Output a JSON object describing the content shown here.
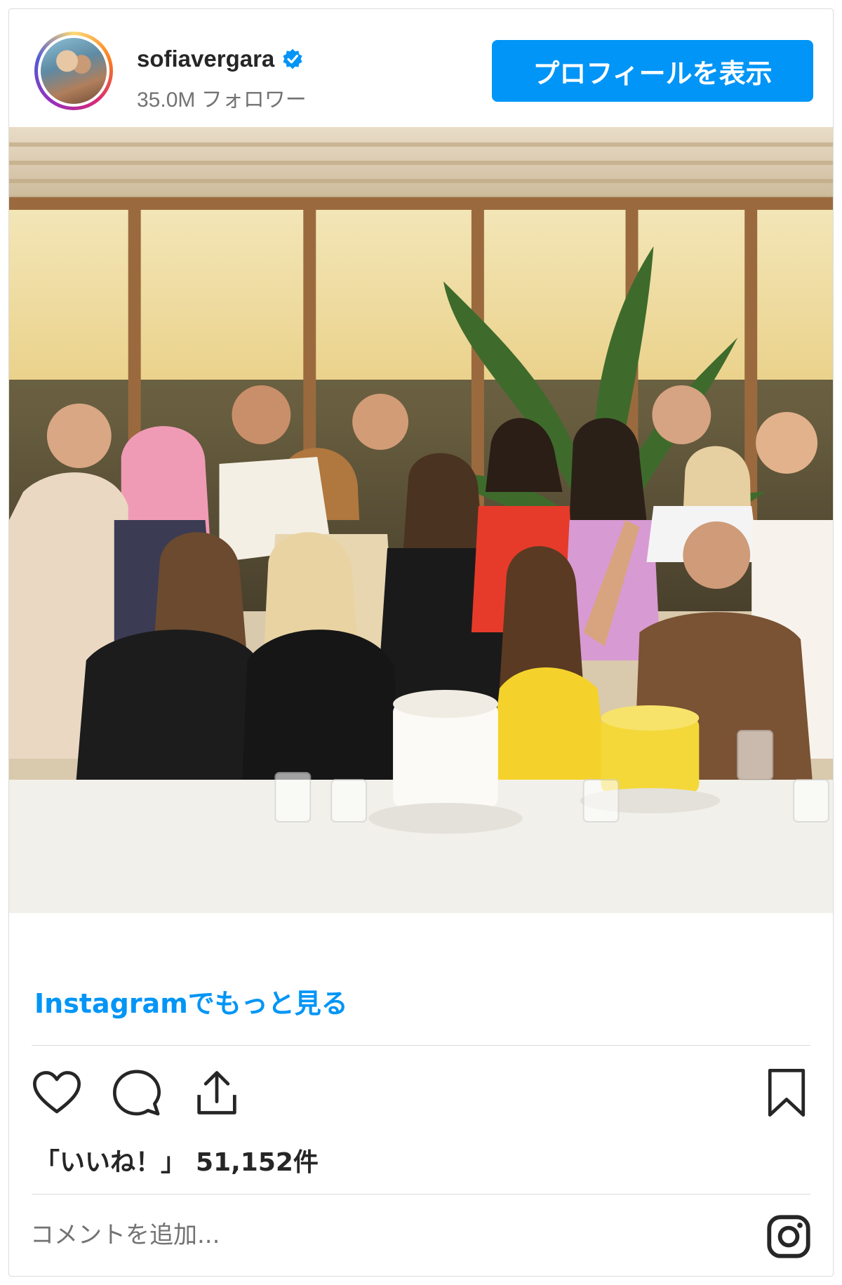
{
  "header": {
    "username": "sofiavergara",
    "followers": "35.0M フォロワー",
    "profile_button": "プロフィールを表示"
  },
  "post": {
    "more_link": "Instagramでもっと見る",
    "likes_label": "「いいね！」",
    "likes_count": "51,152件",
    "comment_placeholder": "コメントを追加..."
  },
  "colors": {
    "accent": "#0095f6",
    "text": "#262626",
    "muted": "#737373",
    "border": "#dbdbdb"
  },
  "icons": [
    "verified-badge-icon",
    "heart-icon",
    "comment-icon",
    "share-icon",
    "bookmark-icon",
    "instagram-logo-icon"
  ]
}
